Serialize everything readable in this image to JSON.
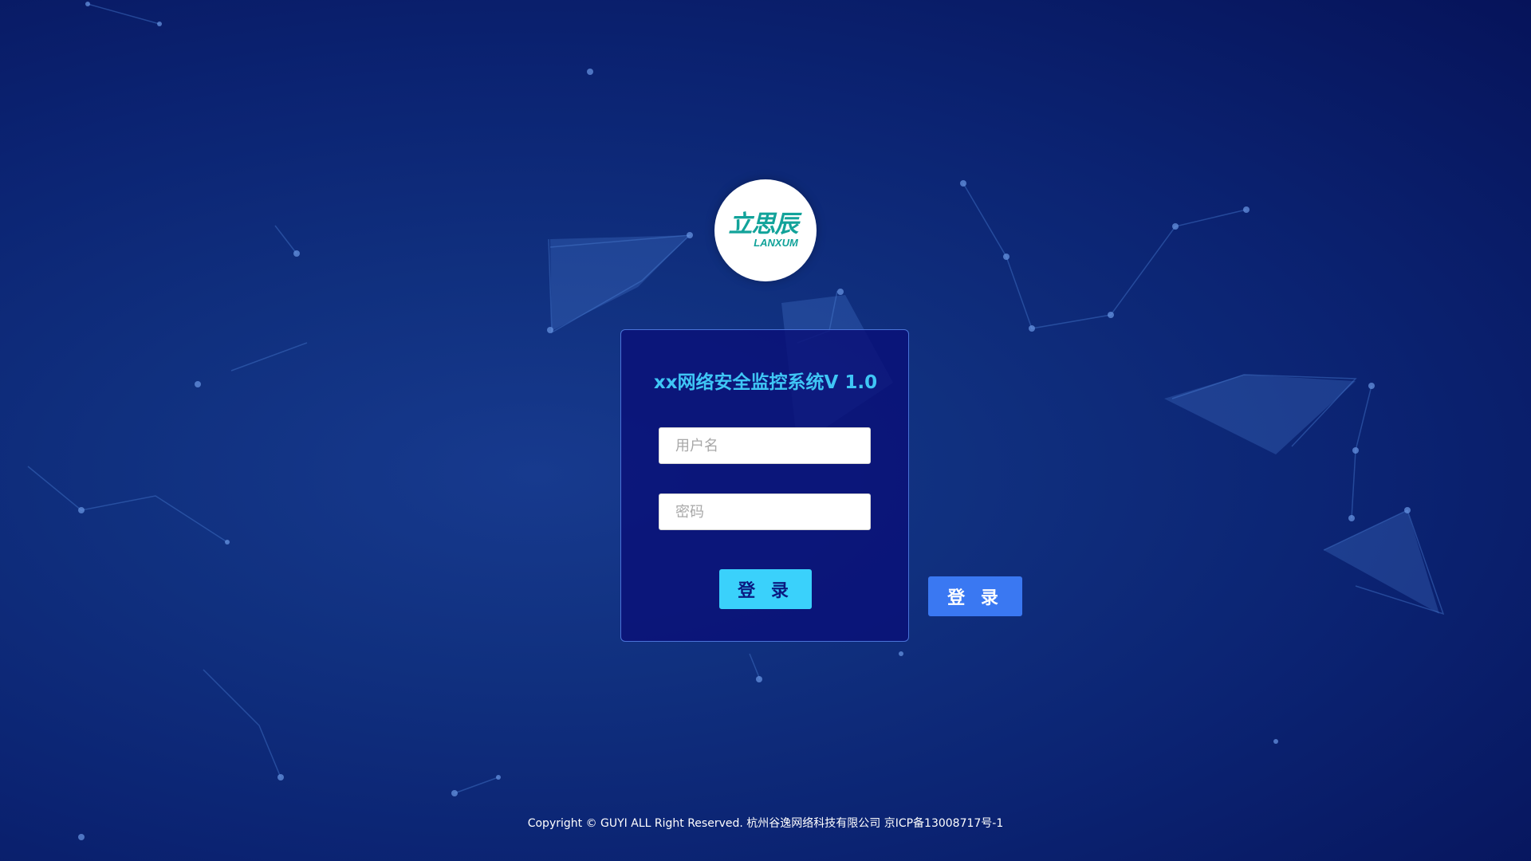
{
  "logo": {
    "cn": "立思辰",
    "en": "LANXUM"
  },
  "login": {
    "title": "xx网络安全监控系统V 1.0",
    "username_placeholder": "用户名",
    "password_placeholder": "密码",
    "submit_label": "登 录"
  },
  "secondary_login_label": "登 录",
  "footer": {
    "text": "Copyright © GUYI ALL Right Reserved. 杭州谷逸网络科技有限公司 京ICP备13008717号-1"
  },
  "colors": {
    "background": "#0b2372",
    "card": "#0a1078",
    "title": "#3fc6f5",
    "primary_button": "#3ad1fb",
    "secondary_button": "#3a78f2",
    "logo": "#12a39a"
  }
}
